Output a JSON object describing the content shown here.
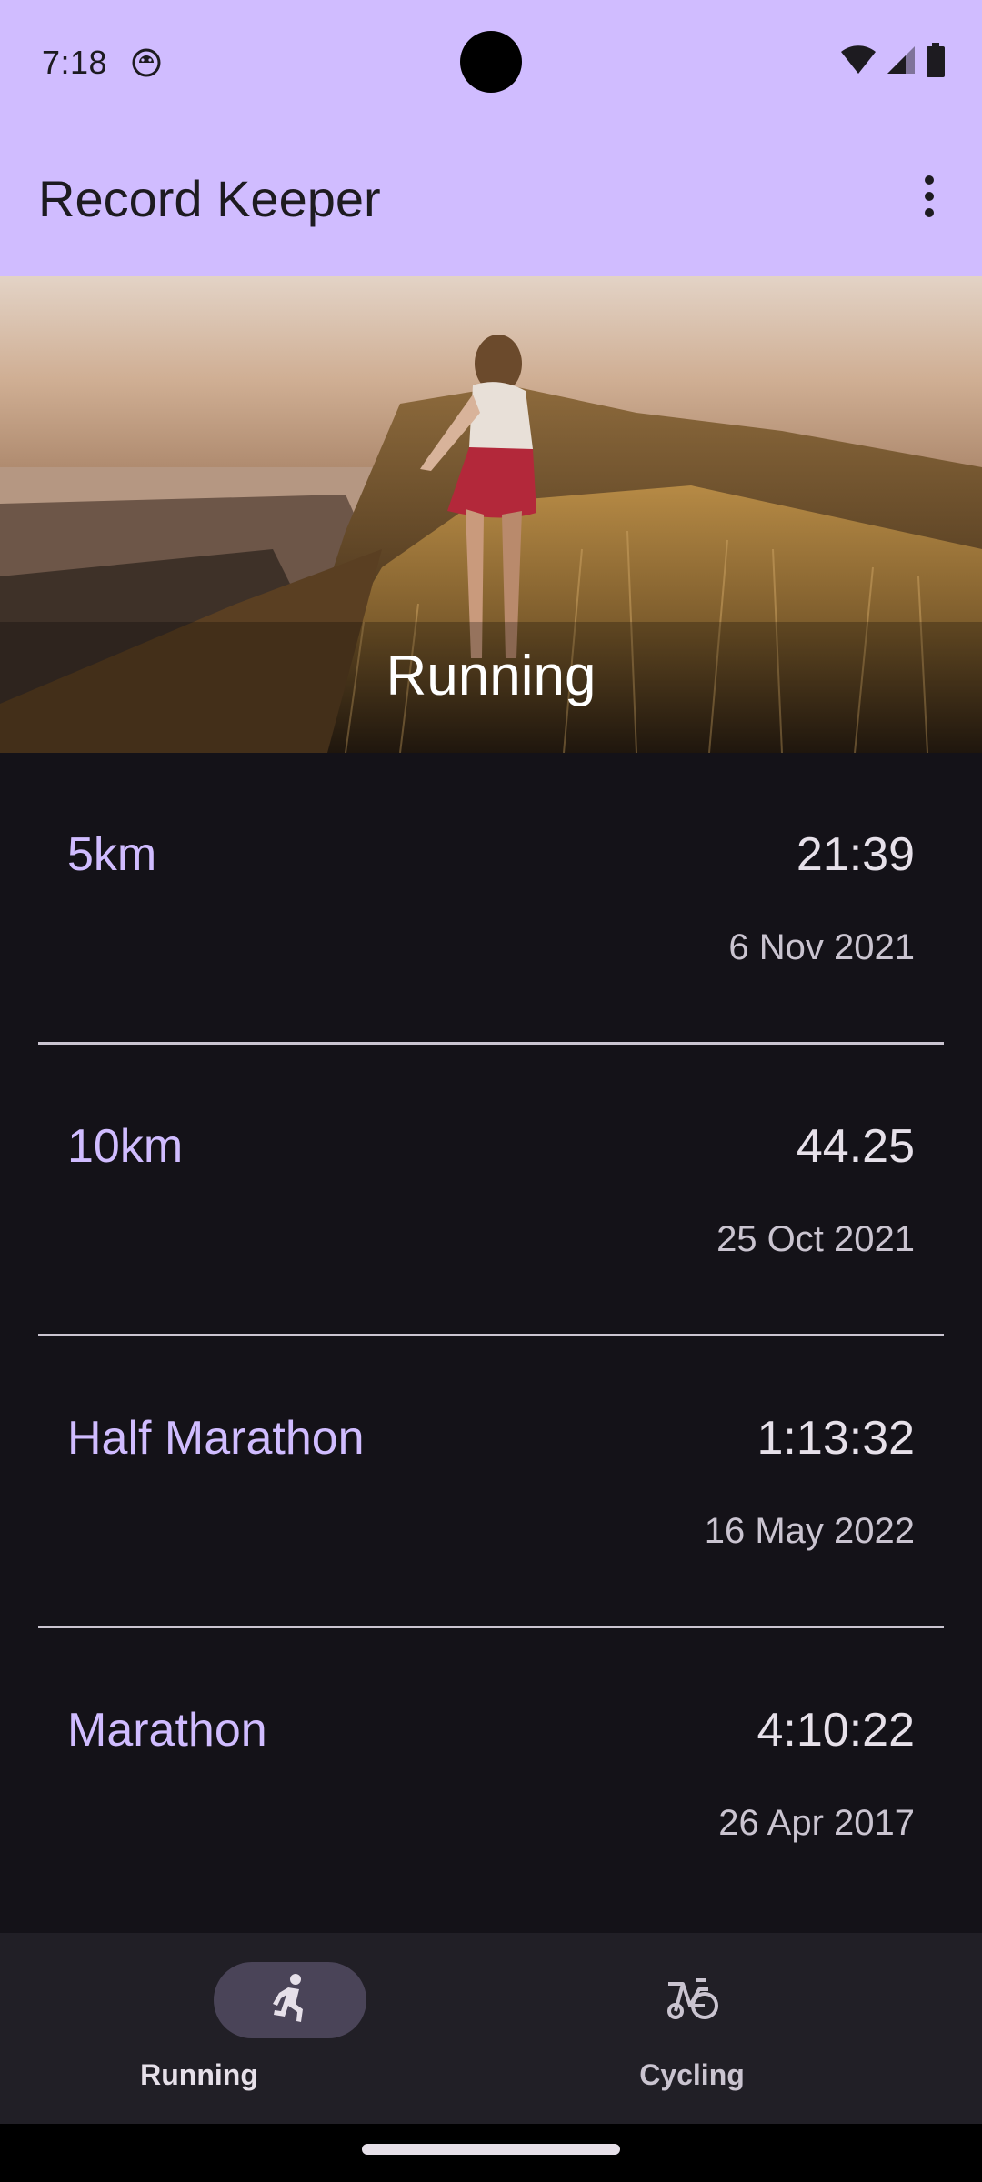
{
  "status_bar": {
    "time": "7:18",
    "notification_icon": "android-debug-icon",
    "icons": [
      "wifi-icon",
      "signal-icon",
      "battery-icon"
    ]
  },
  "app_bar": {
    "title": "Record Keeper",
    "menu_icon": "more-vert-icon"
  },
  "hero": {
    "title": "Running"
  },
  "records": [
    {
      "name": "5km",
      "time": "21:39",
      "date": "6 Nov 2021"
    },
    {
      "name": "10km",
      "time": "44.25",
      "date": "25 Oct 2021"
    },
    {
      "name": "Half Marathon",
      "time": "1:13:32",
      "date": "16 May 2022"
    },
    {
      "name": "Marathon",
      "time": "4:10:22",
      "date": "26 Apr 2017"
    }
  ],
  "bottom_nav": {
    "items": [
      {
        "label": "Running",
        "icon": "run-icon",
        "selected": true
      },
      {
        "label": "Cycling",
        "icon": "bike-icon",
        "selected": false
      }
    ]
  },
  "colors": {
    "primary_container": "#d0bcff",
    "background": "#141218",
    "on_surface": "#e6e0e9",
    "nav_background": "#211f26",
    "nav_indicator": "#4a4458"
  }
}
